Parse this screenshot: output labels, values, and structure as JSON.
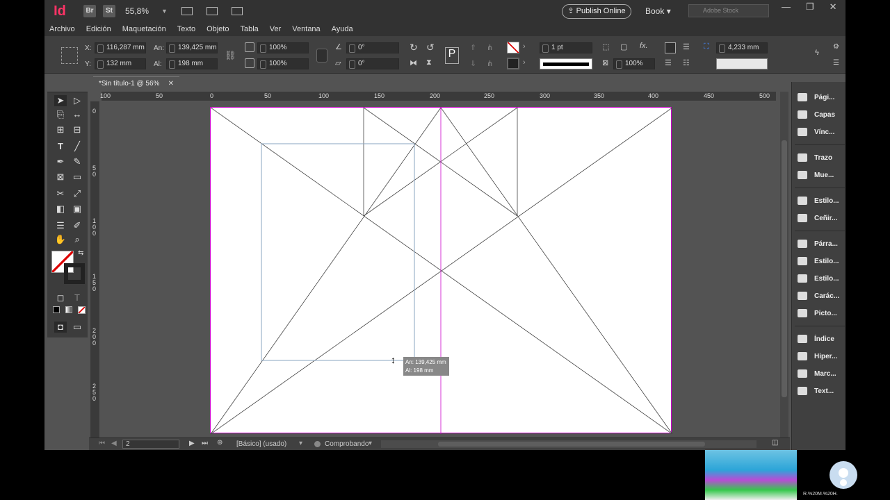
{
  "app": {
    "logo": "Id",
    "bridge": "Br",
    "stock": "St",
    "zoom": "55,8%"
  },
  "topbar": {
    "publish_online": "Publish Online",
    "workspace": "Book",
    "search_placeholder": "Adobe Stock"
  },
  "menu": [
    "Archivo",
    "Edición",
    "Maquetación",
    "Texto",
    "Objeto",
    "Tabla",
    "Ver",
    "Ventana",
    "Ayuda"
  ],
  "control": {
    "x_label": "X:",
    "x_value": "116,287 mm",
    "y_label": "Y:",
    "y_value": "132 mm",
    "w_label": "An:",
    "w_value": "139,425 mm",
    "h_label": "Al:",
    "h_value": "198 mm",
    "scale_x": "100%",
    "scale_y": "100%",
    "rotate": "0°",
    "shear": "0°",
    "stroke_weight": "1 pt",
    "opacity": "100%",
    "gap": "4,233 mm"
  },
  "document": {
    "tab_title": "*Sin título-1 @ 56%",
    "close": "✕"
  },
  "ruler": {
    "h_ticks": [
      "100",
      "50",
      "0",
      "50",
      "100",
      "150",
      "200",
      "250",
      "300",
      "350",
      "400",
      "450",
      "500"
    ],
    "v_ticks": [
      "0",
      "5\n0",
      "1\n0\n0",
      "1\n5\n0",
      "2\n0\n0",
      "2\n5\n0"
    ]
  },
  "tooltip": {
    "width": "An: 139,425 mm",
    "height": "Al: 198 mm"
  },
  "status": {
    "page": "2",
    "master": "[Básico] (usado)",
    "preflight": "Comprobando"
  },
  "panels": [
    {
      "label": "Pági...",
      "icon": "pages-icon"
    },
    {
      "label": "Capas",
      "icon": "layers-icon"
    },
    {
      "label": "Vínc...",
      "icon": "links-icon"
    },
    {
      "label": "Trazo",
      "icon": "stroke-icon"
    },
    {
      "label": "Mue...",
      "icon": "swatches-icon"
    },
    {
      "label": "Estilo...",
      "icon": "object-styles-icon"
    },
    {
      "label": "Ceñir...",
      "icon": "text-wrap-icon"
    },
    {
      "label": "Párra...",
      "icon": "paragraph-icon"
    },
    {
      "label": "Estilo...",
      "icon": "paragraph-styles-icon"
    },
    {
      "label": "Estilo...",
      "icon": "character-styles-icon"
    },
    {
      "label": "Carác...",
      "icon": "character-icon"
    },
    {
      "label": "Picto...",
      "icon": "glyphs-icon"
    },
    {
      "label": "Índice",
      "icon": "index-icon"
    },
    {
      "label": "Hiper...",
      "icon": "hyperlinks-icon"
    },
    {
      "label": "Marc...",
      "icon": "bookmarks-icon"
    },
    {
      "label": "Text...",
      "icon": "text-variables-icon"
    }
  ],
  "webcam": {
    "caption": "R.%20M.%20H."
  },
  "colors": {
    "accent": "#ff3366",
    "page_border": "#cc00cc",
    "guide": "#8aa5c0"
  }
}
